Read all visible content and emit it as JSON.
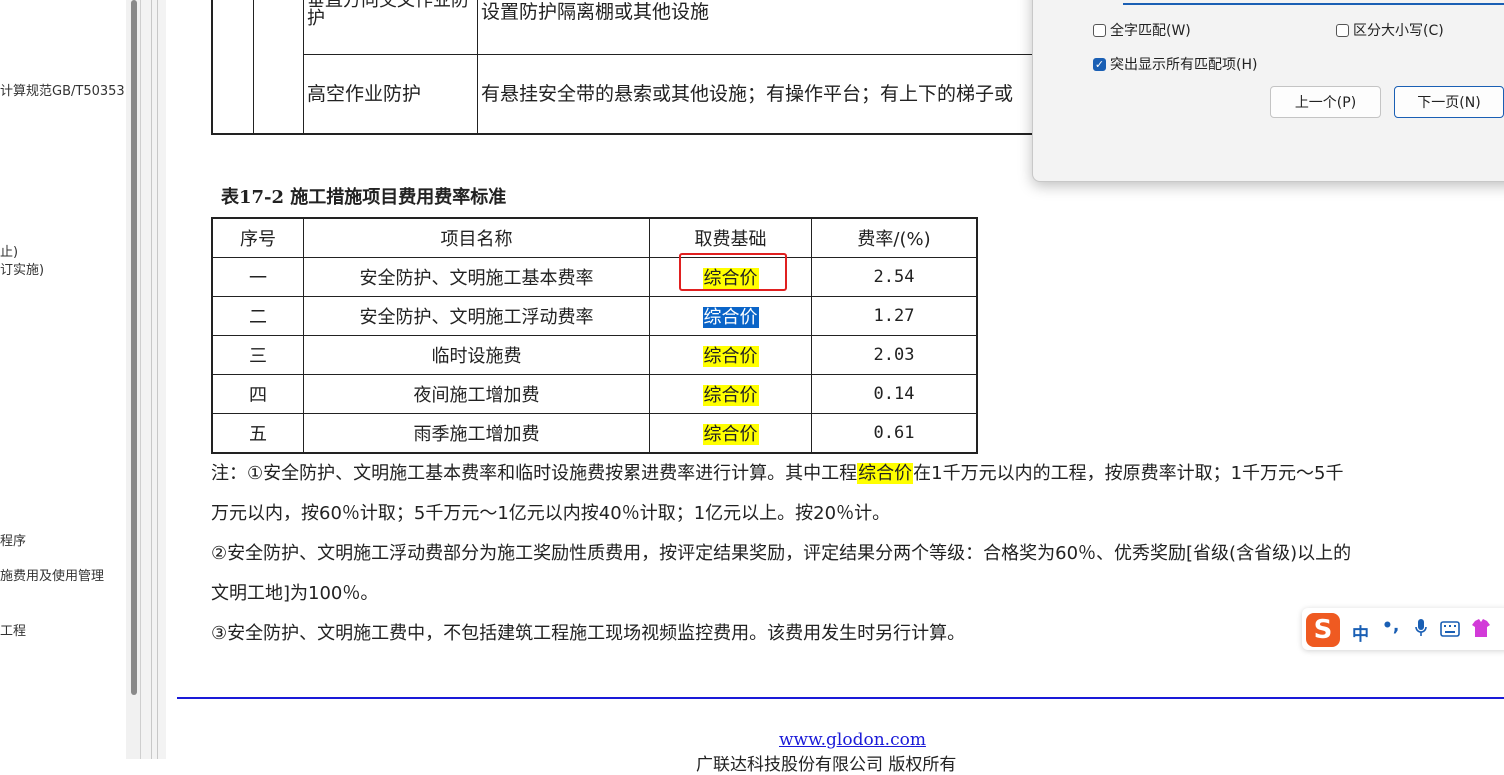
{
  "sidebar": {
    "items": [
      "计算规范GB/T50353",
      "止)",
      "订实施)",
      "程序",
      "施费用及使用管理",
      "工程"
    ]
  },
  "top_table": {
    "row1_name": "垂直方向交叉作业防护",
    "row1_desc": "设置防护隔离棚或其他设施",
    "row2_name": "高空作业防护",
    "row2_desc": "有悬挂安全带的悬索或其他设施；有操作平台；有上下的梯子或"
  },
  "fee_table": {
    "title": "表17-2  施工措施项目费用费率标准",
    "headers": [
      "序号",
      "项目名称",
      "取费基础",
      "费率/(%)"
    ],
    "rows": [
      {
        "no": "一",
        "name": "安全防护、文明施工基本费率",
        "base": "综合价",
        "rate": "2.54"
      },
      {
        "no": "二",
        "name": "安全防护、文明施工浮动费率",
        "base": "综合价",
        "rate": "1.27"
      },
      {
        "no": "三",
        "name": "临时设施费",
        "base": "综合价",
        "rate": "2.03"
      },
      {
        "no": "四",
        "name": "夜间施工增加费",
        "base": "综合价",
        "rate": "0.14"
      },
      {
        "no": "五",
        "name": "雨季施工增加费",
        "base": "综合价",
        "rate": "0.61"
      }
    ]
  },
  "notes": {
    "n1_pre": "注：①安全防护、文明施工基本费率和临时设施费按累进费率进行计算。其中工程",
    "n1_hl": "综合价",
    "n1_post": "在1千万元以内的工程，按原费率计取；1千万元～5千",
    "n1_line2": "万元以内，按60％计取；5千万元～1亿元以内按40％计取；1亿元以上。按20％计。",
    "n2_line1": "②安全防护、文明施工浮动费部分为施工奖励性质费用，按评定结果奖励，评定结果分两个等级：合格奖为60％、优秀奖励[省级(含省级)以上的",
    "n2_line2": "文明工地]为100％。",
    "n3": "③安全防护、文明施工费中，不包括建筑工程施工现场视频监控费用。该费用发生时另行计算。"
  },
  "footer": {
    "link": "www.glodon.com",
    "copyright": "广联达科技股份有限公司 版权所有"
  },
  "find_dialog": {
    "match_whole": "全字匹配(W)",
    "match_case": "区分大小写(C)",
    "highlight_all": "突出显示所有匹配项(H)",
    "prev": "上一个(P)",
    "next": "下一页(N)",
    "highlight_all_checked": true
  },
  "ime": {
    "logo": "S",
    "mode": "中",
    "punct": "•,",
    "icons": [
      "mic-icon",
      "keyboard-icon",
      "skin-icon"
    ]
  },
  "colors": {
    "highlight": "#ffff00",
    "current_match": "#0a64c8",
    "annotation_box": "#e02020",
    "footer_rule": "#1a1ad8",
    "ime_logo": "#ef5a21"
  }
}
